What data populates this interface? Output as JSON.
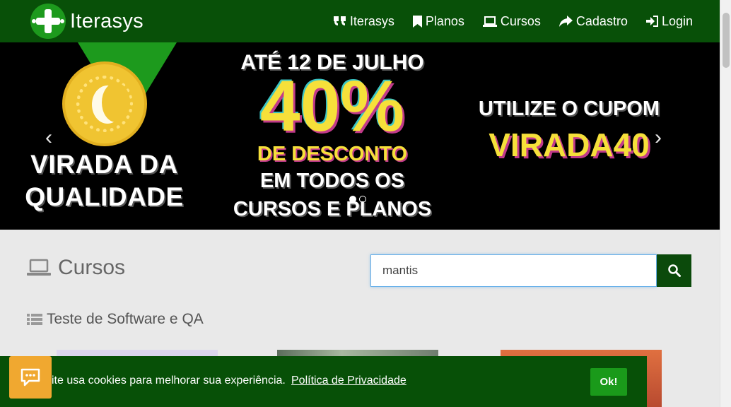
{
  "header": {
    "brand": "Iterasys",
    "nav": [
      {
        "label": "Iterasys",
        "icon": "quote-icon"
      },
      {
        "label": "Planos",
        "icon": "bookmark-icon"
      },
      {
        "label": "Cursos",
        "icon": "laptop-icon"
      },
      {
        "label": "Cadastro",
        "icon": "share-icon"
      },
      {
        "label": "Login",
        "icon": "sign-in-icon"
      }
    ]
  },
  "banner": {
    "left_title_line1": "VIRADA DA",
    "left_title_line2": "QUALIDADE",
    "date_text": "ATÉ 12 DE JULHO",
    "discount": "40%",
    "discount_label": "DE DESCONTO",
    "scope_line1": "EM TODOS OS",
    "scope_line2": "CURSOS E PLANOS",
    "coupon_label": "UTILIZE O CUPOM",
    "coupon_code": "VIRADA40",
    "prev_glyph": "‹",
    "next_glyph": "›"
  },
  "courses": {
    "title": "Cursos",
    "search_value": "mantis",
    "category": "Teste de Software e QA"
  },
  "cookie": {
    "text": "ite usa cookies para melhorar sua experiência.",
    "link": "Política de Privacidade",
    "ok_label": "Ok!"
  },
  "colors": {
    "navbar": "#085008",
    "accent_green": "#1d9a1d",
    "banner_yellow": "#f6e03a",
    "cookie_icon": "#f0a830"
  }
}
